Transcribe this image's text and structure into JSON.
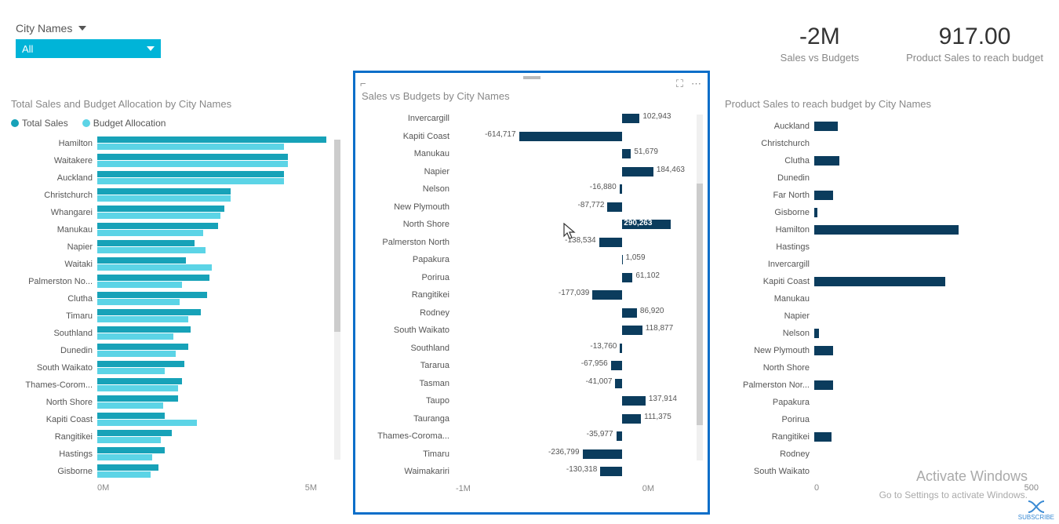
{
  "slicer": {
    "label": "City Names",
    "value": "All"
  },
  "kpis": [
    {
      "value": "-2M",
      "label": "Sales vs Budgets"
    },
    {
      "value": "917.00",
      "label": "Product Sales to reach budget"
    }
  ],
  "panel1": {
    "title": "Total Sales and Budget Allocation by City Names",
    "legend": [
      "Total Sales",
      "Budget Allocation"
    ],
    "axis": [
      "0M",
      "5M"
    ]
  },
  "panel2": {
    "title": "Sales vs Budgets by City Names",
    "axis": [
      "-1M",
      "0M"
    ]
  },
  "panel3": {
    "title": "Product Sales to reach budget by City Names",
    "axis": [
      "0",
      "500"
    ]
  },
  "watermark": {
    "title": "Activate Windows",
    "sub": "Go to Settings to activate Windows."
  },
  "subscribe": "SUBSCRIBE",
  "chart_data": [
    {
      "id": "panel1",
      "type": "bar",
      "orientation": "horizontal",
      "title": "Total Sales and Budget Allocation by City Names",
      "xlabel": "",
      "ylabel": "",
      "xlim": [
        0,
        5000000
      ],
      "categories": [
        "Hamilton",
        "Waitakere",
        "Auckland",
        "Christchurch",
        "Whangarei",
        "Manukau",
        "Napier",
        "Waitaki",
        "Palmerston No...",
        "Clutha",
        "Timaru",
        "Southland",
        "Dunedin",
        "South Waikato",
        "Thames-Corom...",
        "North Shore",
        "Kapiti Coast",
        "Rangitikei",
        "Hastings",
        "Gisborne"
      ],
      "series": [
        {
          "name": "Total Sales",
          "values": [
            5400000,
            4500000,
            4400000,
            3150000,
            3000000,
            2850000,
            2300000,
            2100000,
            2650000,
            2600000,
            2450000,
            2200000,
            2150000,
            2050000,
            2000000,
            1900000,
            1600000,
            1750000,
            1600000,
            1450000
          ]
        },
        {
          "name": "Budget Allocation",
          "values": [
            4400000,
            4500000,
            4400000,
            3150000,
            2900000,
            2500000,
            2550000,
            2700000,
            2000000,
            1950000,
            2150000,
            1800000,
            1850000,
            1600000,
            1900000,
            1550000,
            2350000,
            1500000,
            1300000,
            1250000
          ]
        }
      ]
    },
    {
      "id": "panel2",
      "type": "bar",
      "orientation": "horizontal",
      "title": "Sales vs Budgets by City Names",
      "xlim": [
        -1000000,
        400000
      ],
      "categories": [
        "Invercargill",
        "Kapiti Coast",
        "Manukau",
        "Napier",
        "Nelson",
        "New Plymouth",
        "North Shore",
        "Palmerston North",
        "Papakura",
        "Porirua",
        "Rangitikei",
        "Rodney",
        "South Waikato",
        "Southland",
        "Tararua",
        "Tasman",
        "Taupo",
        "Tauranga",
        "Thames-Coroma...",
        "Timaru",
        "Waimakariri"
      ],
      "values": [
        102943,
        -614717,
        51679,
        184463,
        -16880,
        -87772,
        290263,
        -138534,
        1059,
        61102,
        -177039,
        86920,
        118877,
        -13760,
        -67956,
        -41007,
        137914,
        111375,
        -35977,
        -236799,
        -130318
      ],
      "highlight_index": 6,
      "data_labels": [
        "102,943",
        "-614,717",
        "51,679",
        "184,463",
        "-16,880",
        "-87,772",
        "290,263",
        "-138,534",
        "1,059",
        "61,102",
        "-177,039",
        "86,920",
        "118,877",
        "-13,760",
        "-67,956",
        "-41,007",
        "137,914",
        "111,375",
        "-35,977",
        "-236,799",
        "-130,318"
      ]
    },
    {
      "id": "panel3",
      "type": "bar",
      "orientation": "horizontal",
      "title": "Product Sales to reach budget by City Names",
      "xlim": [
        0,
        500
      ],
      "categories": [
        "Auckland",
        "Christchurch",
        "Clutha",
        "Dunedin",
        "Far North",
        "Gisborne",
        "Hamilton",
        "Hastings",
        "Invercargill",
        "Kapiti Coast",
        "Manukau",
        "Napier",
        "Nelson",
        "New Plymouth",
        "North Shore",
        "Palmerston Nor...",
        "Papakura",
        "Porirua",
        "Rangitikei",
        "Rodney",
        "South Waikato"
      ],
      "values": [
        55,
        0,
        60,
        0,
        45,
        8,
        340,
        0,
        0,
        310,
        0,
        0,
        12,
        45,
        0,
        45,
        0,
        0,
        40,
        0,
        0
      ]
    }
  ]
}
